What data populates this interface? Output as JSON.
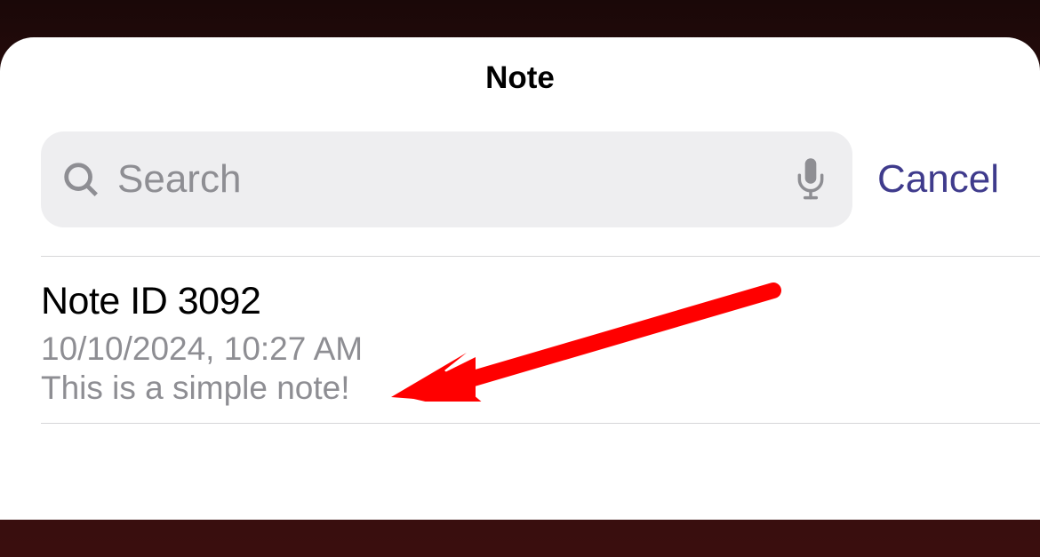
{
  "header": {
    "title": "Note"
  },
  "search": {
    "placeholder": "Search",
    "value": "",
    "cancel_label": "Cancel"
  },
  "notes": [
    {
      "title": "Note ID 3092",
      "timestamp": "10/10/2024, 10:27 AM",
      "preview": "This is a simple note!"
    }
  ],
  "annotation": {
    "arrow_color": "#ff0000"
  }
}
